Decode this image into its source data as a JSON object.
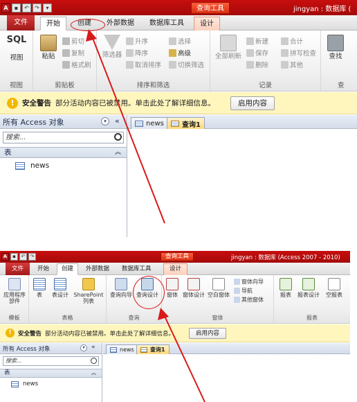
{
  "shot1": {
    "qat_icons": [
      "app-icon",
      "save-icon",
      "undo-icon",
      "redo-icon",
      "customize-icon"
    ],
    "app_letter": "A",
    "context_title": "查询工具",
    "window_title": "jingyan : 数据库 (",
    "tabs": [
      "文件",
      "开始",
      "创建",
      "外部数据",
      "数据库工具",
      "设计"
    ],
    "groups": {
      "view": {
        "label": "视图",
        "sql": "SQL",
        "view_btn": "视图"
      },
      "clipboard": {
        "label": "剪贴板",
        "paste": "粘贴",
        "cut": "剪切",
        "copy": "复制",
        "format_painter": "格式刷"
      },
      "sort_filter": {
        "label": "排序和筛选",
        "filter": "筛选器",
        "asc": "升序",
        "desc": "降序",
        "clear_sort": "取消排序",
        "selection": "选择",
        "advanced": "高级",
        "toggle_filter": "切换筛选"
      },
      "records": {
        "label": "记录",
        "refresh_all": "全部刷新",
        "new": "新建",
        "save": "保存",
        "delete": "删除",
        "totals": "合计",
        "spelling": "拼写检查",
        "more": "其他"
      },
      "find": {
        "label": "查",
        "find": "查找"
      }
    },
    "warning": {
      "title": "安全警告",
      "message": "部分活动内容已被禁用。单击此处了解详细信息。",
      "button": "启用内容"
    },
    "nav": {
      "header": "所有 Access 对象",
      "search_placeholder": "搜索...",
      "section": "表",
      "items": [
        "news"
      ]
    },
    "doc_tabs": [
      "news",
      "查询1"
    ]
  },
  "shot2": {
    "context_title": "查询工具",
    "window_title": "jingyan : 数据库 (Access 2007 - 2010)",
    "tabs": [
      "文件",
      "开始",
      "创建",
      "外部数据",
      "数据库工具",
      "设计"
    ],
    "groups": {
      "templates": {
        "label": "模板",
        "app_parts": "应用程序",
        "app_parts2": "部件"
      },
      "tables": {
        "label": "表格",
        "table": "表",
        "table_design": "表设计",
        "sharepoint": "SharePoint",
        "sharepoint2": "列表"
      },
      "queries": {
        "label": "查询",
        "query_wizard": "查询向导",
        "query_design": "查询设计"
      },
      "forms": {
        "label": "窗体",
        "form": "窗体",
        "form_design": "窗体设计",
        "blank_form": "空白窗体",
        "form_wizard": "窗体向导",
        "navigation": "导航",
        "more_forms": "其他窗体"
      },
      "reports": {
        "label": "报表",
        "report": "报表",
        "report_design": "报表设计",
        "blank_report": "空报表"
      }
    },
    "warning": {
      "title": "安全警告",
      "message": "部分活动内容已被禁用。单击此处了解详细信息。",
      "button": "启用内容"
    },
    "nav": {
      "header": "所有 Access 对象",
      "search_placeholder": "搜索...",
      "section": "表",
      "items": [
        "news"
      ]
    },
    "doc_tabs": [
      "news",
      "查询1"
    ]
  },
  "colors": {
    "title_red": "#b80f0f",
    "annotation_red": "#d91a1a",
    "warning_bg": "#fff6bd"
  }
}
